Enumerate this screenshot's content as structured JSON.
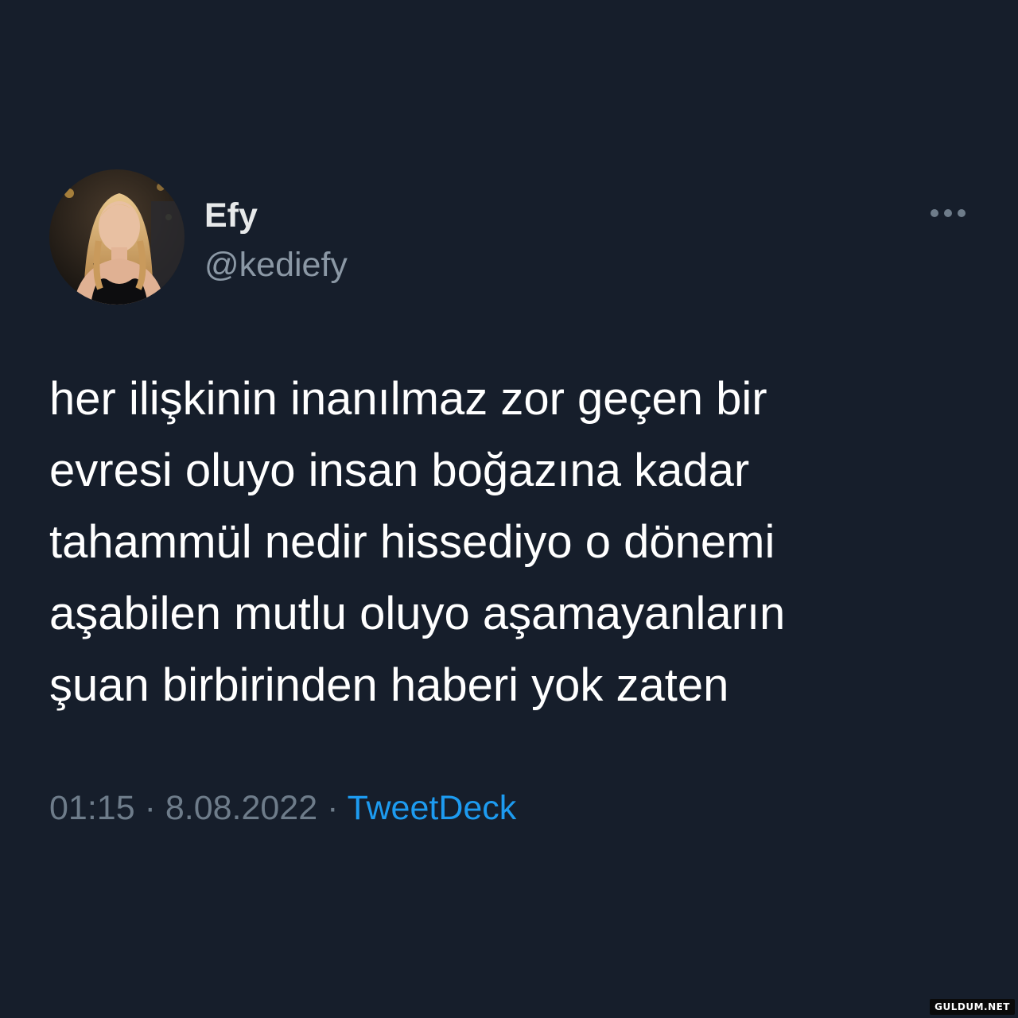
{
  "tweet": {
    "author": {
      "display_name": "Efy",
      "handle": "@kediefy",
      "avatar_icon": "profile-photo-avatar"
    },
    "more_icon": "more-options-icon",
    "text_lines": [
      "her ilişkinin inanılmaz zor geçen bir",
      "evresi oluyo insan boğazına kadar",
      "tahammül nedir hissediyo o dönemi",
      "aşabilen mutlu oluyo aşamayanların",
      "şuan birbirinden haberi yok zaten"
    ],
    "time": "01:15",
    "separator": "·",
    "date": "8.08.2022",
    "source": "TweetDeck"
  },
  "watermark": "GULDUM.NET",
  "colors": {
    "background": "#161e2b",
    "text_primary": "#ffffff",
    "text_secondary": "#8b98a5",
    "link": "#1d9bf0"
  }
}
